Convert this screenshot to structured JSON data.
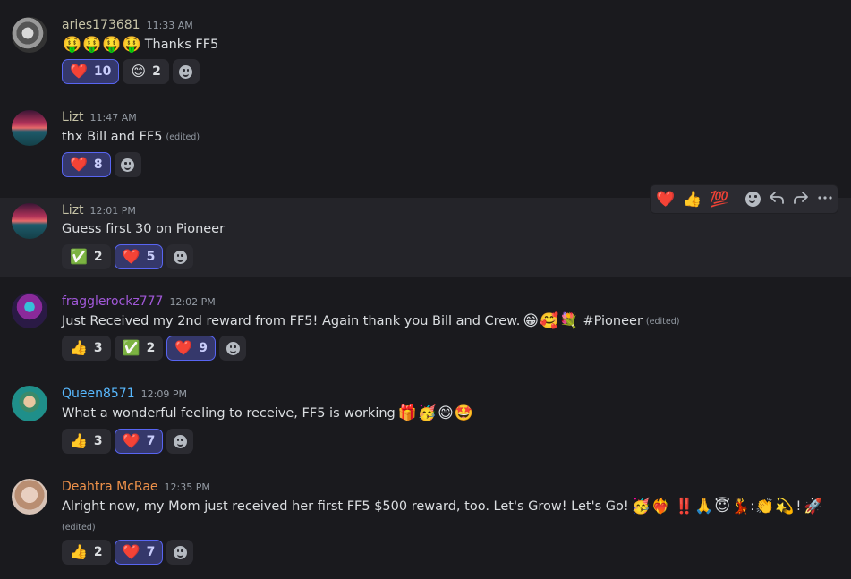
{
  "messages": [
    {
      "username": "aries173681",
      "username_color": "#c5c2a6",
      "time": "11:33 AM",
      "emojis": [
        "🤑",
        "🤑",
        "🤑",
        "🤑"
      ],
      "text": "Thanks FF5",
      "edited": "",
      "reactions": [
        {
          "emoji": "❤️",
          "count": "10",
          "me": true
        },
        {
          "emoji": "😊",
          "count": "2",
          "me": false
        }
      ]
    },
    {
      "username": "Lizt",
      "username_color": "#c5c2a6",
      "time": "11:47 AM",
      "text": "thx Bill  and FF5",
      "edited": "(edited)",
      "reactions": [
        {
          "emoji": "❤️",
          "count": "8",
          "me": true
        }
      ]
    },
    {
      "username": "Lizt",
      "username_color": "#c5c2a6",
      "time": "12:01 PM",
      "text": "Guess first 30 on Pioneer",
      "edited": "",
      "reactions": [
        {
          "emoji": "✅",
          "count": "2",
          "me": false
        },
        {
          "emoji": "❤️",
          "count": "5",
          "me": true
        }
      ]
    },
    {
      "username": "fragglerockz777",
      "username_color": "#a158d8",
      "time": "12:02 PM",
      "text": "Just Received my 2nd reward from FF5! Again thank you Bill and Crew.",
      "emojis": [
        "😁",
        "🥰",
        "💐"
      ],
      "text_after": "#Pioneer",
      "edited": "(edited)",
      "reactions": [
        {
          "emoji": "👍",
          "count": "3",
          "me": false
        },
        {
          "emoji": "✅",
          "count": "2",
          "me": false
        },
        {
          "emoji": "❤️",
          "count": "9",
          "me": true
        }
      ]
    },
    {
      "username": "Queen8571",
      "username_color": "#58b9ff",
      "time": "12:09 PM",
      "text": "What a wonderful feeling to receive, FF5 is working",
      "emojis": [
        "🎁",
        "🥳",
        "😄",
        "🤩"
      ],
      "edited": "",
      "reactions": [
        {
          "emoji": "👍",
          "count": "3",
          "me": false
        },
        {
          "emoji": "❤️",
          "count": "7",
          "me": true
        }
      ]
    },
    {
      "username": "Deahtra McRae",
      "username_color": "#f0924a",
      "time": "12:35 PM",
      "text": "Alright now, my Mom just received her first FF5 $500 reward, too. Let's Grow! Let's Go!",
      "emojis": [
        "🥳",
        "❤️‍🔥",
        "‼️",
        "🙏",
        "😇",
        "💃",
        ":",
        "👏",
        "💫",
        "!",
        "🚀"
      ],
      "edited": "(edited)",
      "reactions": [
        {
          "emoji": "👍",
          "count": "2",
          "me": false
        },
        {
          "emoji": "❤️",
          "count": "7",
          "me": true
        }
      ]
    }
  ],
  "toolbar": {
    "quick_reactions": [
      "❤️",
      "👍",
      "💯"
    ]
  },
  "icons": [
    "add-reaction-icon",
    "reply-icon",
    "forward-icon",
    "more-icon"
  ]
}
